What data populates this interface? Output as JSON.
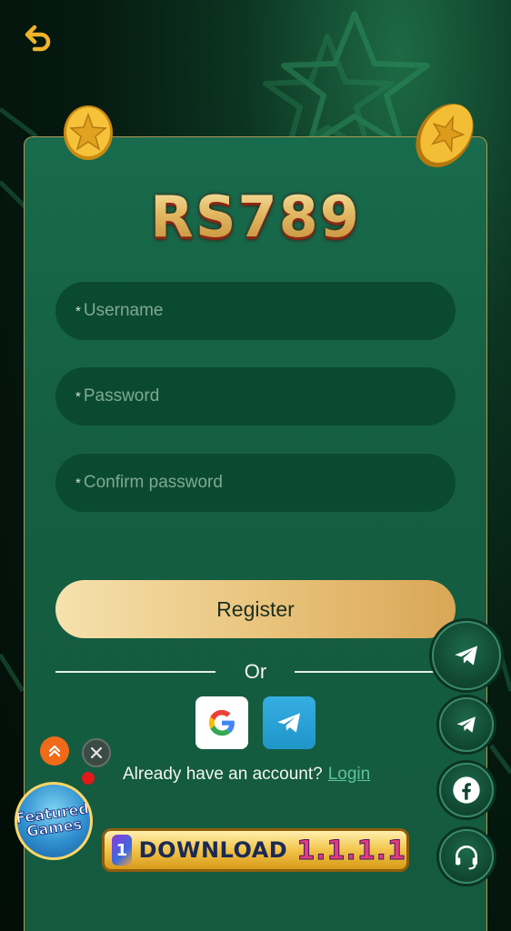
{
  "brand": {
    "logo_text": "RS789"
  },
  "form": {
    "required_mark": "*",
    "username_placeholder": "Username",
    "password_placeholder": "Password",
    "confirm_placeholder": "Confirm password",
    "register_label": "Register",
    "or_label": "Or"
  },
  "social_login": [
    {
      "name": "google-icon"
    },
    {
      "name": "telegram-icon"
    }
  ],
  "account": {
    "prompt": "Already have an account?",
    "login_label": "Login"
  },
  "download_banner": {
    "app_badge": "1",
    "label": "DOWNLOAD",
    "version": "1.1.1.1"
  },
  "featured_badge": {
    "line1": "Featured",
    "line2": "Games"
  },
  "side_buttons": [
    "telegram-icon",
    "telegram-icon",
    "facebook-icon",
    "headset-icon"
  ],
  "colors": {
    "card_bg": "#186b4c",
    "field_bg": "#0a4a30",
    "register_gradient_start": "#f6e1ad",
    "register_gradient_end": "#d9a656",
    "link": "#5fc39a",
    "back_arrow": "#f0b429"
  }
}
